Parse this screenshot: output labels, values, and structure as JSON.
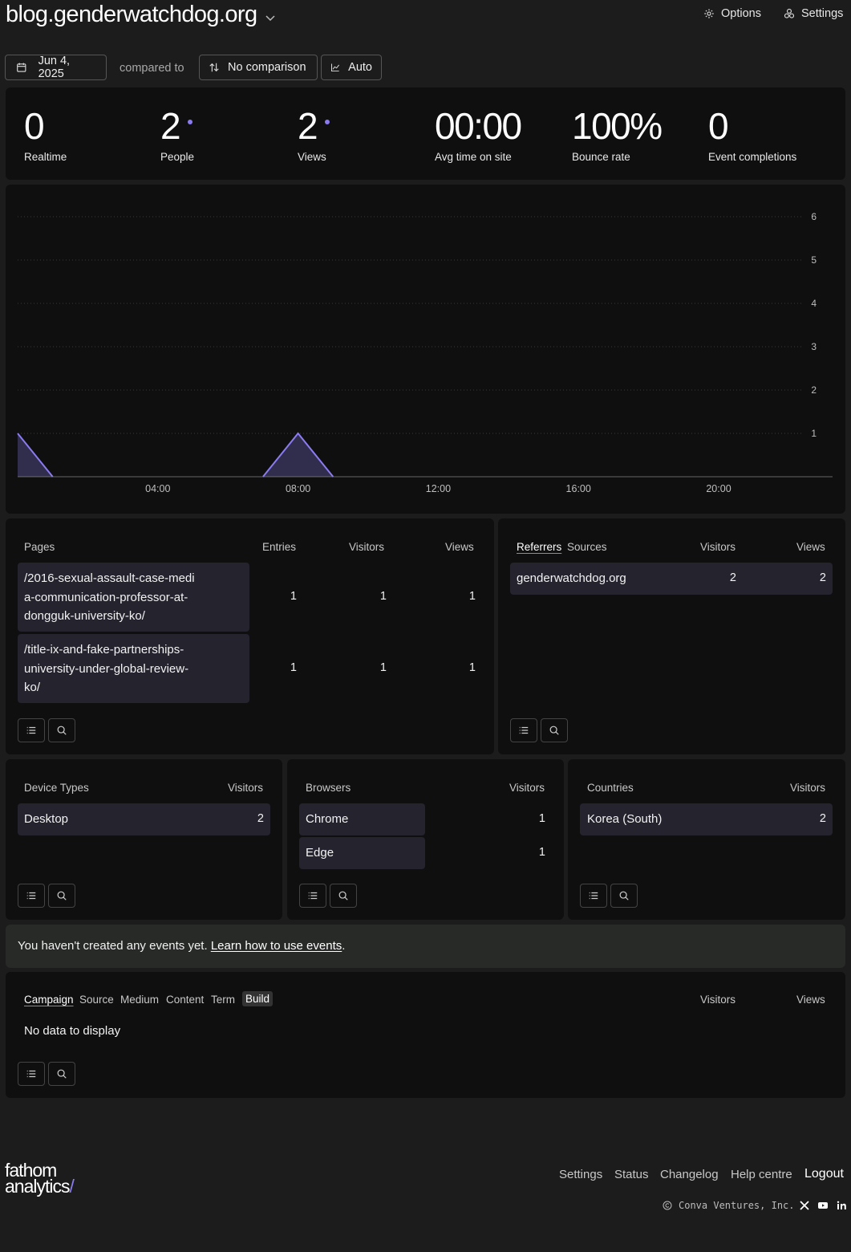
{
  "header": {
    "site": "blog.genderwatchdog.org",
    "options_label": "Options",
    "settings_label": "Settings"
  },
  "toolbar": {
    "date_label": "Jun 4, 2025",
    "compared_to": "compared to",
    "comparison_label": "No comparison",
    "interval_label": "Auto"
  },
  "stats": [
    {
      "value": "0",
      "label": "Realtime"
    },
    {
      "value": "2",
      "label": "People"
    },
    {
      "value": "2",
      "label": "Views"
    },
    {
      "value": "00:00",
      "label": "Avg time on site"
    },
    {
      "value": "100%",
      "label": "Bounce rate"
    },
    {
      "value": "0",
      "label": "Event completions"
    }
  ],
  "chart_data": {
    "type": "area",
    "x_ticks": [
      "04:00",
      "08:00",
      "12:00",
      "16:00",
      "20:00"
    ],
    "y_ticks": [
      "1",
      "2",
      "3",
      "4",
      "5",
      "6"
    ],
    "ylim": [
      0,
      6
    ],
    "grid": true,
    "series": [
      {
        "values": [
          {
            "hour": 0,
            "views": 1
          },
          {
            "hour": 1,
            "views": 0
          },
          {
            "hour": 7,
            "views": 0
          },
          {
            "hour": 8,
            "views": 1
          },
          {
            "hour": 9,
            "views": 0
          }
        ]
      }
    ],
    "color": "#8a7cf0"
  },
  "pages_panel": {
    "title": "Pages",
    "col_entries": "Entries",
    "col_visitors": "Visitors",
    "col_views": "Views",
    "rows": [
      {
        "line1": "/2016-sexual-assault-case-medi",
        "line2": "a-communication-professor-at-",
        "line3": "dongguk-university-ko/",
        "entries": "1",
        "visitors": "1",
        "views": "1"
      },
      {
        "line1": "/title-ix-and-fake-partnerships-",
        "line2": "university-under-global-review-",
        "line3": "ko/",
        "entries": "1",
        "visitors": "1",
        "views": "1"
      }
    ]
  },
  "referrers_panel": {
    "tab_referrers": "Referrers",
    "tab_sources": "Sources",
    "col_visitors": "Visitors",
    "col_views": "Views",
    "rows": [
      {
        "name": "genderwatchdog.org",
        "visitors": "2",
        "views": "2"
      }
    ]
  },
  "devices_panel": {
    "title": "Device Types",
    "col_visitors": "Visitors",
    "rows": [
      {
        "name": "Desktop",
        "visitors": "2"
      }
    ]
  },
  "browsers_panel": {
    "title": "Browsers",
    "col_visitors": "Visitors",
    "rows": [
      {
        "name": "Chrome",
        "visitors": "1"
      },
      {
        "name": "Edge",
        "visitors": "1"
      }
    ]
  },
  "countries_panel": {
    "title": "Countries",
    "col_visitors": "Visitors",
    "rows": [
      {
        "name": "Korea (South)",
        "visitors": "2"
      }
    ]
  },
  "events_banner": {
    "text": "You haven't created any events yet.",
    "link": "Learn how to use events",
    "period": "."
  },
  "utm_panel": {
    "tabs": [
      "Campaign",
      "Source",
      "Medium",
      "Content",
      "Term",
      "Build"
    ],
    "col_visitors": "Visitors",
    "col_views": "Views",
    "empty": "No data to display"
  },
  "footer": {
    "logo_line1": "fathom",
    "logo_line2": "analytics",
    "logo_slash": "/",
    "links": [
      "Settings",
      "Status",
      "Changelog",
      "Help centre",
      "Logout"
    ],
    "copyright": "Conva Ventures, Inc."
  }
}
